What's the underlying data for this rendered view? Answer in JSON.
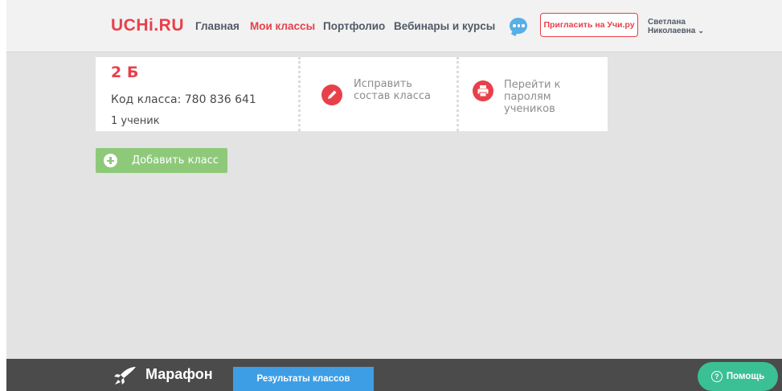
{
  "header": {
    "logo": "UCHi.RU",
    "nav": [
      "Главная",
      "Мои классы",
      "Портфолио",
      "Вебинары и курсы"
    ],
    "active_nav": "Мои классы",
    "chat_icon": "chat-bubble-icon",
    "invite_label": "Пригласить на Учи.ру",
    "user": {
      "first_name": "Светлана",
      "patronymic": "Николаевна"
    }
  },
  "class_card": {
    "name": "2 Б",
    "code": "Код класса: 780 836 641",
    "count": "1 ученик",
    "edit_label": "Исправить состав класса",
    "passwords_label": "Перейти к паролям учеников"
  },
  "add_class_label": "Добавить класс",
  "footer": {
    "marathon": "Марафон",
    "results_label": "Результаты классов",
    "help_label": "Помощь"
  },
  "colors": {
    "accent": "#e8404b",
    "green": "#8ec97a",
    "blue": "#3e9ee5",
    "help": "#3bbf95",
    "chat": "#58aee6"
  }
}
